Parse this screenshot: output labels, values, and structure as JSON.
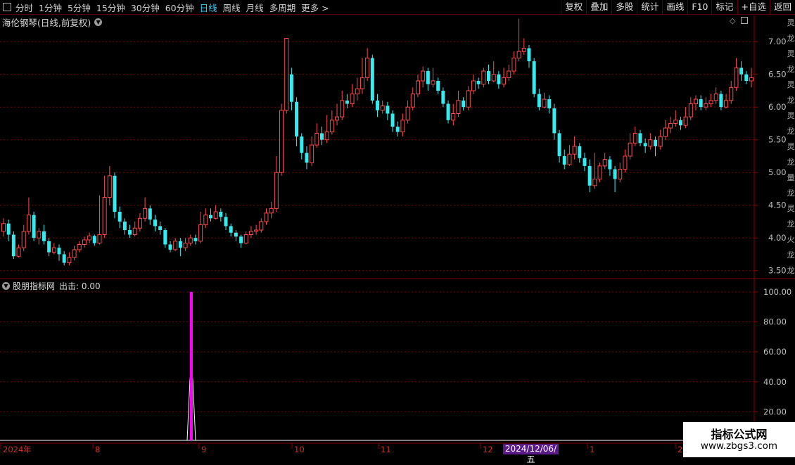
{
  "toolbar": {
    "periods": [
      "分时",
      "1分钟",
      "5分钟",
      "15分钟",
      "30分钟",
      "60分钟",
      "日线",
      "周线",
      "月线",
      "多周期",
      "更多 >"
    ],
    "active_period": "日线",
    "actions": [
      "复权",
      "叠加",
      "多股",
      "统计",
      "画线",
      "F10",
      "标记",
      "+自选",
      "返回"
    ]
  },
  "main_chart": {
    "title": "海伦钢琴(日线,前复权)",
    "y_ticks": [
      "7.00",
      "6.50",
      "6.00",
      "5.50",
      "5.00",
      "4.50",
      "4.00",
      "3.50"
    ],
    "right_strip_text": [
      "灵",
      "龙",
      "灵",
      "龙",
      "灵",
      "龙",
      "灵",
      "龙",
      "灵",
      "龙",
      "量",
      "龙",
      "灵",
      "龙",
      "火",
      "龙",
      "龙"
    ]
  },
  "sub_chart": {
    "title": "股朋指标网",
    "indicator_label": "出击: 0.00",
    "y_ticks": [
      "100.00",
      "80.00",
      "60.00",
      "40.00",
      "20.00"
    ]
  },
  "x_axis": {
    "labels": [
      "2024年",
      "8",
      "9",
      "10",
      "11",
      "12",
      "1",
      "2"
    ],
    "cursor_date": "2024/12/06/五"
  },
  "watermark": {
    "title": "指标公式网",
    "url": "www.zbgs3.com"
  },
  "colors": {
    "up": "#ff4a4a",
    "down": "#34ecf0",
    "signal": "#ff00ff",
    "grid": "#7a0000",
    "active": "#2fd3ff"
  },
  "chart_data": {
    "type": "candlestick",
    "y_range": [
      3.4,
      7.4
    ],
    "indicator_range": [
      0,
      100
    ],
    "indicator_signal": {
      "name": "出击",
      "peak": 100
    },
    "candles": [
      [
        4.1,
        4.22,
        4.3,
        4.02
      ],
      [
        4.22,
        4.05,
        4.28,
        3.95
      ],
      [
        4.05,
        3.72,
        4.1,
        3.68
      ],
      [
        3.72,
        3.85,
        3.9,
        3.7
      ],
      [
        3.85,
        4.1,
        4.2,
        3.8
      ],
      [
        4.1,
        4.35,
        4.62,
        4.05
      ],
      [
        4.35,
        4.0,
        4.4,
        3.95
      ],
      [
        4.0,
        4.1,
        4.15,
        3.9
      ],
      [
        4.1,
        3.95,
        4.2,
        3.9
      ],
      [
        3.95,
        3.78,
        4.0,
        3.72
      ],
      [
        3.78,
        3.85,
        3.92,
        3.75
      ],
      [
        3.85,
        3.75,
        3.9,
        3.65
      ],
      [
        3.75,
        3.62,
        3.8,
        3.58
      ],
      [
        3.62,
        3.7,
        3.78,
        3.58
      ],
      [
        3.7,
        3.82,
        3.88,
        3.66
      ],
      [
        3.82,
        3.9,
        3.95,
        3.78
      ],
      [
        3.9,
        3.97,
        4.02,
        3.85
      ],
      [
        3.97,
        4.03,
        4.08,
        3.92
      ],
      [
        4.03,
        3.92,
        4.05,
        3.88
      ],
      [
        3.92,
        4.05,
        4.65,
        3.9
      ],
      [
        4.05,
        4.62,
        4.95,
        4.0
      ],
      [
        4.62,
        4.95,
        5.1,
        4.5
      ],
      [
        4.95,
        4.4,
        5.0,
        4.3
      ],
      [
        4.4,
        4.25,
        4.48,
        4.15
      ],
      [
        4.25,
        4.12,
        4.3,
        4.05
      ],
      [
        4.12,
        4.05,
        4.2,
        4.0
      ],
      [
        4.05,
        4.15,
        4.25,
        4.02
      ],
      [
        4.15,
        4.3,
        4.38,
        4.1
      ],
      [
        4.3,
        4.45,
        4.62,
        4.25
      ],
      [
        4.45,
        4.28,
        4.5,
        4.2
      ],
      [
        4.28,
        4.18,
        4.35,
        4.1
      ],
      [
        4.18,
        4.12,
        4.25,
        4.05
      ],
      [
        4.12,
        3.9,
        4.15,
        3.85
      ],
      [
        3.9,
        3.82,
        3.95,
        3.78
      ],
      [
        3.82,
        3.95,
        4.0,
        3.8
      ],
      [
        3.95,
        3.85,
        4.0,
        3.72
      ],
      [
        3.85,
        3.92,
        4.0,
        3.8
      ],
      [
        3.92,
        4.0,
        4.05,
        3.88
      ],
      [
        4.0,
        3.95,
        4.05,
        3.9
      ],
      [
        3.95,
        4.2,
        4.4,
        3.92
      ],
      [
        4.2,
        4.35,
        4.45,
        4.15
      ],
      [
        4.35,
        4.3,
        4.45,
        4.25
      ],
      [
        4.3,
        4.4,
        4.5,
        4.28
      ],
      [
        4.4,
        4.32,
        4.45,
        4.25
      ],
      [
        4.32,
        4.18,
        4.38,
        4.12
      ],
      [
        4.18,
        4.08,
        4.22,
        4.02
      ],
      [
        4.08,
        4.02,
        4.12,
        3.95
      ],
      [
        4.02,
        3.92,
        4.05,
        3.85
      ],
      [
        3.92,
        4.05,
        4.1,
        3.9
      ],
      [
        4.05,
        4.1,
        4.18,
        4.0
      ],
      [
        4.1,
        4.12,
        4.2,
        4.05
      ],
      [
        4.12,
        4.25,
        4.3,
        4.08
      ],
      [
        4.25,
        4.38,
        4.45,
        4.2
      ],
      [
        4.38,
        4.45,
        4.55,
        4.3
      ],
      [
        4.45,
        5.0,
        5.25,
        4.4
      ],
      [
        5.0,
        5.95,
        6.05,
        4.95
      ],
      [
        5.95,
        7.05,
        7.05,
        5.9
      ],
      [
        6.5,
        6.08,
        6.6,
        5.95
      ],
      [
        6.08,
        5.55,
        6.15,
        5.4
      ],
      [
        5.55,
        5.3,
        5.6,
        5.2
      ],
      [
        5.3,
        5.15,
        5.4,
        5.05
      ],
      [
        5.15,
        5.42,
        5.55,
        5.1
      ],
      [
        5.42,
        5.6,
        5.75,
        5.38
      ],
      [
        5.6,
        5.5,
        5.7,
        5.42
      ],
      [
        5.5,
        5.62,
        5.88,
        5.45
      ],
      [
        5.62,
        5.8,
        5.95,
        5.58
      ],
      [
        5.8,
        5.85,
        6.05,
        5.72
      ],
      [
        5.85,
        6.1,
        6.25,
        5.8
      ],
      [
        6.1,
        6.05,
        6.2,
        5.98
      ],
      [
        6.05,
        6.2,
        6.35,
        6.0
      ],
      [
        6.2,
        6.28,
        6.45,
        6.1
      ],
      [
        6.28,
        6.45,
        6.75,
        6.2
      ],
      [
        6.45,
        6.75,
        6.9,
        6.4
      ],
      [
        6.75,
        6.1,
        6.8,
        6.05
      ],
      [
        6.1,
        5.95,
        6.2,
        5.85
      ],
      [
        5.95,
        6.02,
        6.1,
        5.9
      ],
      [
        6.02,
        5.9,
        6.08,
        5.8
      ],
      [
        5.9,
        5.7,
        5.95,
        5.62
      ],
      [
        5.7,
        5.62,
        5.78,
        5.55
      ],
      [
        5.62,
        5.8,
        5.9,
        5.55
      ],
      [
        5.8,
        6.0,
        6.1,
        5.75
      ],
      [
        6.0,
        6.2,
        6.3,
        5.95
      ],
      [
        6.2,
        6.4,
        6.5,
        6.15
      ],
      [
        6.4,
        6.55,
        6.62,
        6.3
      ],
      [
        6.55,
        6.35,
        6.6,
        6.25
      ],
      [
        6.35,
        6.4,
        6.6,
        6.3
      ],
      [
        6.4,
        6.25,
        6.45,
        6.2
      ],
      [
        6.25,
        6.05,
        6.3,
        6.0
      ],
      [
        6.05,
        5.8,
        6.1,
        5.75
      ],
      [
        5.8,
        5.9,
        6.05,
        5.72
      ],
      [
        5.9,
        6.1,
        6.25,
        5.85
      ],
      [
        6.1,
        6.0,
        6.15,
        5.95
      ],
      [
        6.0,
        6.25,
        6.32,
        5.95
      ],
      [
        6.25,
        6.4,
        6.5,
        6.2
      ],
      [
        6.4,
        6.35,
        6.45,
        6.28
      ],
      [
        6.35,
        6.55,
        6.6,
        6.3
      ],
      [
        6.55,
        6.4,
        6.65,
        6.35
      ],
      [
        6.4,
        6.5,
        6.7,
        6.38
      ],
      [
        6.5,
        6.35,
        6.55,
        6.28
      ],
      [
        6.35,
        6.45,
        6.6,
        6.3
      ],
      [
        6.45,
        6.55,
        6.65,
        6.4
      ],
      [
        6.55,
        6.75,
        6.85,
        6.5
      ],
      [
        6.75,
        6.85,
        7.35,
        6.7
      ],
      [
        6.85,
        6.9,
        7.05,
        6.8
      ],
      [
        6.9,
        6.7,
        6.95,
        6.6
      ],
      [
        6.7,
        6.2,
        6.75,
        6.15
      ],
      [
        6.2,
        6.0,
        6.28,
        5.95
      ],
      [
        6.0,
        6.12,
        6.22,
        5.98
      ],
      [
        6.12,
        5.98,
        6.18,
        5.9
      ],
      [
        5.98,
        5.6,
        6.05,
        5.5
      ],
      [
        5.6,
        5.25,
        5.65,
        5.15
      ],
      [
        5.25,
        5.12,
        5.35,
        5.05
      ],
      [
        5.12,
        5.28,
        5.42,
        5.1
      ],
      [
        5.28,
        5.4,
        5.55,
        5.2
      ],
      [
        5.4,
        5.22,
        5.45,
        5.15
      ],
      [
        5.22,
        5.1,
        5.3,
        5.02
      ],
      [
        5.1,
        4.8,
        5.2,
        4.7
      ],
      [
        4.8,
        4.9,
        5.3,
        4.75
      ],
      [
        4.9,
        5.1,
        5.15,
        4.85
      ],
      [
        5.1,
        5.2,
        5.3,
        5.05
      ],
      [
        5.2,
        5.05,
        5.25,
        4.95
      ],
      [
        5.05,
        4.9,
        5.1,
        4.7
      ],
      [
        4.9,
        5.05,
        5.15,
        4.85
      ],
      [
        5.05,
        5.25,
        5.35,
        5.0
      ],
      [
        5.25,
        5.45,
        5.6,
        5.2
      ],
      [
        5.45,
        5.6,
        5.7,
        5.4
      ],
      [
        5.6,
        5.45,
        5.65,
        5.4
      ],
      [
        5.45,
        5.4,
        5.52,
        5.3
      ],
      [
        5.4,
        5.5,
        5.6,
        5.35
      ],
      [
        5.5,
        5.4,
        5.55,
        5.25
      ],
      [
        5.4,
        5.55,
        5.65,
        5.35
      ],
      [
        5.55,
        5.68,
        5.8,
        5.5
      ],
      [
        5.68,
        5.75,
        5.85,
        5.6
      ],
      [
        5.75,
        5.8,
        5.95,
        5.7
      ],
      [
        5.8,
        5.72,
        5.85,
        5.65
      ],
      [
        5.72,
        5.85,
        6.0,
        5.68
      ],
      [
        5.85,
        6.05,
        6.15,
        5.8
      ],
      [
        6.05,
        6.12,
        6.18,
        5.95
      ],
      [
        6.12,
        6.0,
        6.18,
        5.95
      ],
      [
        6.0,
        6.05,
        6.15,
        5.95
      ],
      [
        6.05,
        6.1,
        6.2,
        6.0
      ],
      [
        6.1,
        6.2,
        6.3,
        6.05
      ],
      [
        6.2,
        6.0,
        6.25,
        5.95
      ],
      [
        6.0,
        6.1,
        6.2,
        5.98
      ],
      [
        6.1,
        6.3,
        6.4,
        6.05
      ],
      [
        6.3,
        6.6,
        6.75,
        6.25
      ],
      [
        6.6,
        6.5,
        6.7,
        6.4
      ],
      [
        6.5,
        6.4,
        6.55,
        6.35
      ],
      [
        6.4,
        6.45,
        6.6,
        6.3
      ]
    ]
  }
}
